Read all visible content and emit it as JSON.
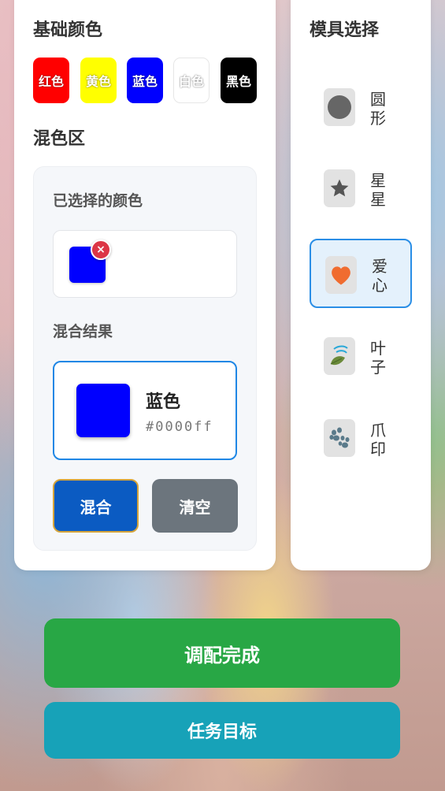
{
  "left_panel": {
    "base_colors_title": "基础颜色",
    "base_colors": [
      {
        "label": "红色",
        "color": "#ff0000"
      },
      {
        "label": "黄色",
        "color": "#ffff00"
      },
      {
        "label": "蓝色",
        "color": "#0000ff"
      },
      {
        "label": "白色",
        "color": "#ffffff"
      },
      {
        "label": "黑色",
        "color": "#000000"
      }
    ],
    "mix_area_title": "混色区",
    "selected_title": "已选择的颜色",
    "selected_colors": [
      {
        "color": "#0000ff",
        "remove_label": "×"
      }
    ],
    "result_title": "混合结果",
    "result": {
      "name": "蓝色",
      "hex": "#0000ff",
      "color": "#0000ff"
    },
    "mix_button": "混合",
    "clear_button": "清空"
  },
  "right_panel": {
    "title": "模具选择",
    "molds": [
      {
        "label": "圆形",
        "icon": "circle-icon",
        "selected": false
      },
      {
        "label": "星星",
        "icon": "star-icon",
        "selected": false
      },
      {
        "label": "爱心",
        "icon": "heart-icon",
        "selected": true
      },
      {
        "label": "叶子",
        "icon": "leaf-icon",
        "selected": false
      },
      {
        "label": "爪印",
        "icon": "paw-icon",
        "selected": false
      }
    ]
  },
  "bottom": {
    "finish_button": "调配完成",
    "task_button": "任务目标"
  },
  "colors": {
    "accent_blue": "#1f87e5",
    "mix_button_bg": "#0b5bc2",
    "clear_button_bg": "#6c757d",
    "finish_button_bg": "#28a745",
    "task_button_bg": "#17a2b8",
    "remove_badge": "#dc3545"
  }
}
